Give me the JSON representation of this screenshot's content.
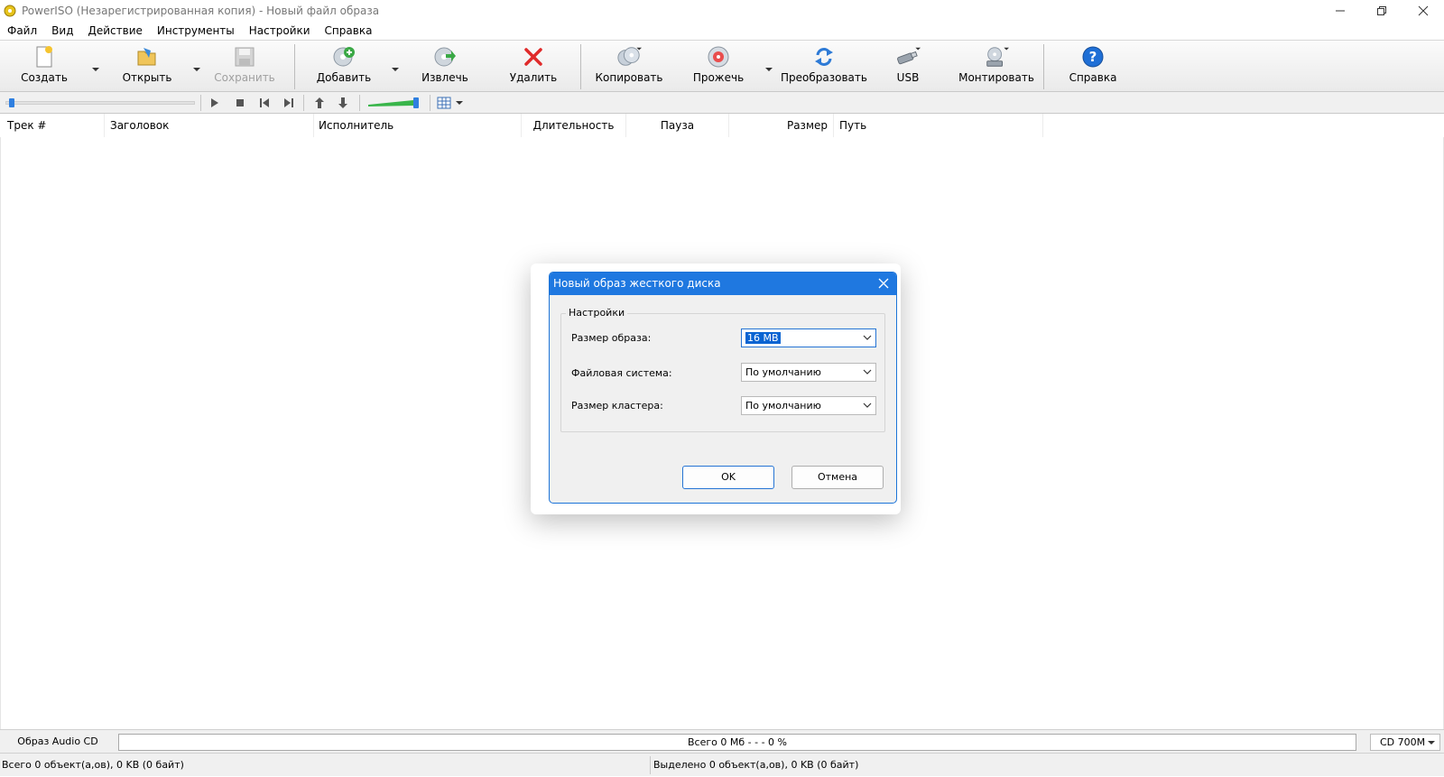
{
  "window": {
    "title": "PowerISO (Незарегистрированная копия) - Новый файл образа"
  },
  "menu": [
    "Файл",
    "Вид",
    "Действие",
    "Инструменты",
    "Настройки",
    "Справка"
  ],
  "toolbar": {
    "create": "Создать",
    "open": "Открыть",
    "save": "Сохранить",
    "add": "Добавить",
    "extract": "Извлечь",
    "delete": "Удалить",
    "copy": "Копировать",
    "burn": "Прожечь",
    "convert": "Преобразовать",
    "usb": "USB",
    "mount": "Монтировать",
    "help": "Справка"
  },
  "columns": {
    "track": "Трек #",
    "title": "Заголовок",
    "artist": "Исполнитель",
    "duration": "Длительность",
    "pause": "Пауза",
    "size": "Размер",
    "path": "Путь"
  },
  "bottom": {
    "image_type": "Образ Audio CD",
    "capacity_text": "Всего  0 Мб   - - -  0 %",
    "media": "CD 700M"
  },
  "status": {
    "left": "Всего 0 объект(а,ов), 0 KB (0 байт)",
    "right": "Выделено 0 объект(а,ов), 0 KB (0 байт)"
  },
  "dialog": {
    "title": "Новый образ жесткого диска",
    "group_label": "Настройки",
    "image_size_label": "Размер образа:",
    "image_size_value": "16 MB",
    "fs_label": "Файловая система:",
    "fs_value": "По умолчанию",
    "cluster_label": "Размер кластера:",
    "cluster_value": "По умолчанию",
    "ok": "OK",
    "cancel": "Отмена"
  },
  "colors": {
    "dialog_title_bg": "#1f78e0",
    "selection": "#0a64d2"
  }
}
